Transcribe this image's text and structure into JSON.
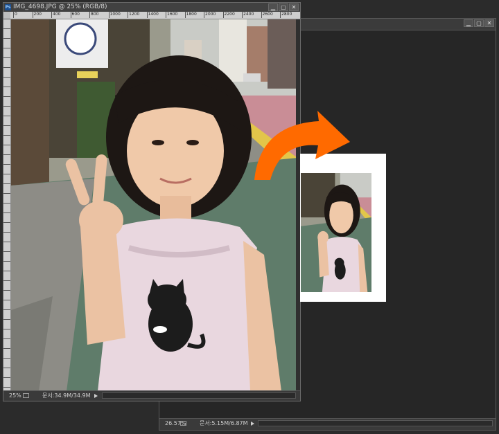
{
  "front_window": {
    "title": "IMG_4698.JPG @ 25% (RGB/8)",
    "ruler_marks": [
      "0",
      "200",
      "400",
      "600",
      "800",
      "1000",
      "1200",
      "1400",
      "1600",
      "1800",
      "2000",
      "2200",
      "2400",
      "2600",
      "2800"
    ],
    "status": {
      "zoom": "25%",
      "doc_info": "문서:34.9M/34.9M"
    }
  },
  "back_window": {
    "status": {
      "zoom": "26.57%",
      "doc_info": "문서:5.15M/6.87M"
    }
  },
  "window_buttons": {
    "minimize": "▁",
    "maximize": "▢",
    "close": "✕"
  },
  "colors": {
    "arrow": "#ff6a00",
    "workspace": "#2b2b2b",
    "shirt": "#e9d7df"
  }
}
